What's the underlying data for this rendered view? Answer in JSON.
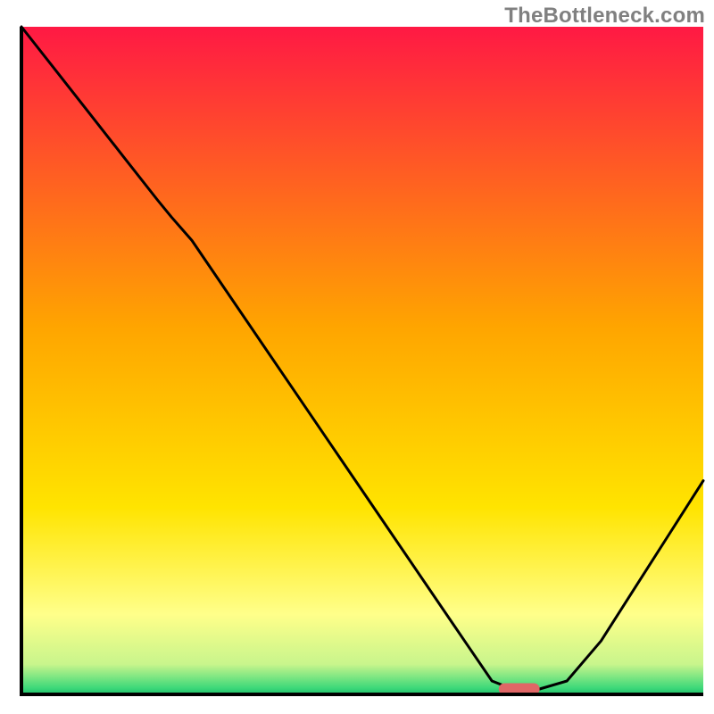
{
  "watermark": "TheBottleneck.com",
  "chart_data": {
    "type": "line",
    "x": [
      0.0,
      0.05,
      0.1,
      0.15,
      0.2,
      0.22,
      0.25,
      0.3,
      0.35,
      0.4,
      0.45,
      0.5,
      0.55,
      0.6,
      0.65,
      0.69,
      0.72,
      0.76,
      0.8,
      0.85,
      0.9,
      0.95,
      1.0
    ],
    "values": [
      1.0,
      0.935,
      0.87,
      0.805,
      0.74,
      0.715,
      0.68,
      0.605,
      0.53,
      0.455,
      0.38,
      0.305,
      0.23,
      0.155,
      0.08,
      0.02,
      0.008,
      0.008,
      0.02,
      0.08,
      0.16,
      0.24,
      0.32
    ],
    "title": "",
    "xlabel": "",
    "ylabel": "",
    "xlim": [
      0,
      1
    ],
    "ylim": [
      0,
      1
    ],
    "indicator": {
      "x_start": 0.7,
      "x_end": 0.76,
      "color": "#e06666"
    },
    "background": {
      "type": "vertical_gradient",
      "stops": [
        {
          "offset": 0.0,
          "color": "#ff1944"
        },
        {
          "offset": 0.45,
          "color": "#ffa500"
        },
        {
          "offset": 0.72,
          "color": "#ffe400"
        },
        {
          "offset": 0.88,
          "color": "#ffff8a"
        },
        {
          "offset": 0.955,
          "color": "#c8f58c"
        },
        {
          "offset": 0.99,
          "color": "#3fd97a"
        },
        {
          "offset": 1.0,
          "color": "#1fc06a"
        }
      ]
    },
    "axes_color": "#000000",
    "line_color": "#000000"
  }
}
